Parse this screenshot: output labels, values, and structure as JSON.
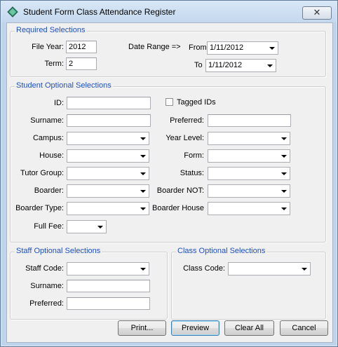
{
  "window": {
    "title": "Student Form Class Attendance Register",
    "close_symbol": "✕"
  },
  "required": {
    "title": "Required Selections",
    "file_year_label": "File Year:",
    "file_year_value": "2012",
    "term_label": "Term:",
    "term_value": "2",
    "date_range_label": "Date Range =>",
    "from_label": "From",
    "from_value": "1/11/2012",
    "to_label": "To",
    "to_value": "1/11/2012"
  },
  "student": {
    "title": "Student Optional Selections",
    "id_label": "ID:",
    "tagged_label": "Tagged IDs",
    "surname_label": "Surname:",
    "preferred_label": "Preferred:",
    "campus_label": "Campus:",
    "year_level_label": "Year Level:",
    "house_label": "House:",
    "form_label": "Form:",
    "tutor_group_label": "Tutor Group:",
    "status_label": "Status:",
    "boarder_label": "Boarder:",
    "boarder_not_label": "Boarder NOT:",
    "boarder_type_label": "Boarder Type:",
    "boarder_house_label": "Boarder House",
    "full_fee_label": "Full Fee:"
  },
  "staff": {
    "title": "Staff Optional Selections",
    "staff_code_label": "Staff Code:",
    "surname_label": "Surname:",
    "preferred_label": "Preferred:"
  },
  "class": {
    "title": "Class Optional Selections",
    "class_code_label": "Class Code:"
  },
  "buttons": {
    "print": "Print...",
    "preview": "Preview",
    "clear_all": "Clear All",
    "cancel": "Cancel"
  },
  "icons": {
    "app": "app-diamond-icon",
    "dropdown": "chevron-down-icon"
  }
}
